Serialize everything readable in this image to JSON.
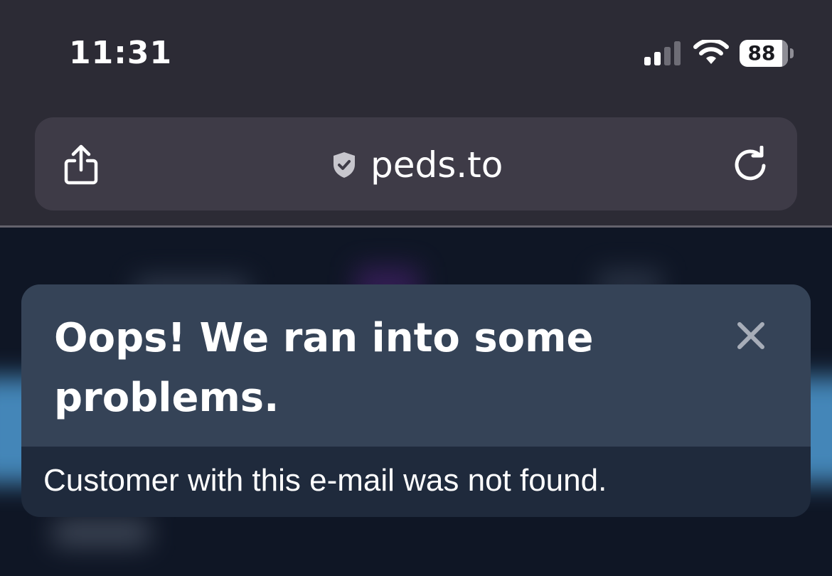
{
  "status_bar": {
    "time": "11:31",
    "battery_level": "88",
    "signal_bars_active": 2,
    "signal_bars_total": 4
  },
  "browser": {
    "url": "peds.to",
    "icons": {
      "share": "share-icon",
      "secure": "shield-check-icon",
      "reload": "reload-icon"
    }
  },
  "alert": {
    "title": "Oops! We ran into some problems.",
    "message": "Customer with this e-mail was not found.",
    "close_icon": "close-icon"
  },
  "colors": {
    "chrome_background": "#2c2b35",
    "address_bar": "#3e3b47",
    "alert_header": "#354357",
    "alert_body": "#1f2a3c",
    "page_background": "#0f1625"
  }
}
